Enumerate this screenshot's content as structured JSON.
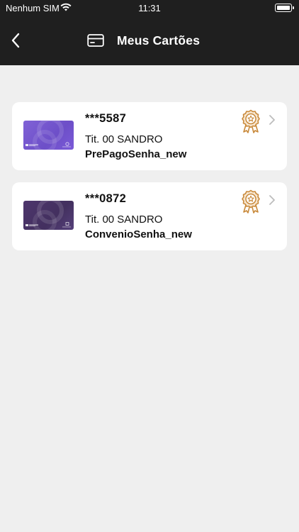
{
  "status": {
    "carrier": "Nenhum SIM",
    "time": "11:31"
  },
  "header": {
    "title": "Meus Cartões",
    "background": "#1f1f1f"
  },
  "cards": [
    {
      "number": "***5587",
      "holder": "Tit. 00 SANDRO",
      "product": "PrePagoSenha_new",
      "thumb_color": "#7a5ad6",
      "badge_icon": "award-medal-icon"
    },
    {
      "number": "***0872",
      "holder": "Tit. 00 SANDRO",
      "product": "ConvenioSenha_new",
      "thumb_color": "#4b3468",
      "badge_icon": "award-medal-icon"
    }
  ],
  "colors": {
    "page_bg": "#efefef",
    "medal": "#c98a3c"
  }
}
